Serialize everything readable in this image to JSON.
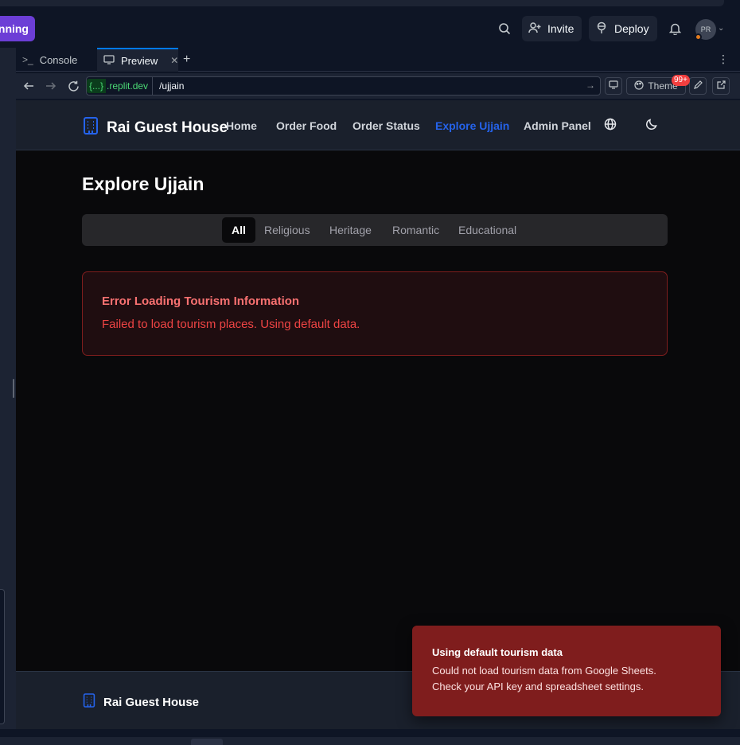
{
  "app_header": {
    "run_label": "nning",
    "invite_label": "Invite",
    "deploy_label": "Deploy",
    "avatar_initials": "PR"
  },
  "tabs": [
    {
      "label": "Console"
    },
    {
      "label": "Preview"
    }
  ],
  "urlbar": {
    "domain_braces": "{...}",
    "domain": ".replit.dev",
    "path": "/ujjain",
    "theme_label": "Theme",
    "badge": "99+"
  },
  "site": {
    "brand": "Rai Guest House",
    "nav": [
      "Home",
      "Order Food",
      "Order Status",
      "Explore Ujjain",
      "Admin Panel"
    ],
    "active_nav": "Explore Ujjain",
    "page_title": "Explore Ujjain",
    "filters": [
      "All",
      "Religious",
      "Heritage",
      "Romantic",
      "Educational"
    ],
    "active_filter": "All",
    "error": {
      "title": "Error Loading Tourism Information",
      "message": "Failed to load tourism places. Using default data."
    },
    "footer_brand": "Rai Guest House"
  },
  "toast": {
    "title": "Using default tourism data",
    "line1": "Could not load tourism data from Google Sheets.",
    "line2": "Check your API key and spreadsheet settings."
  },
  "colors": {
    "accent": "#2563eb",
    "run": "#6c3ed6",
    "error_text": "#ef4444",
    "toast_bg": "#7f1d1d"
  }
}
